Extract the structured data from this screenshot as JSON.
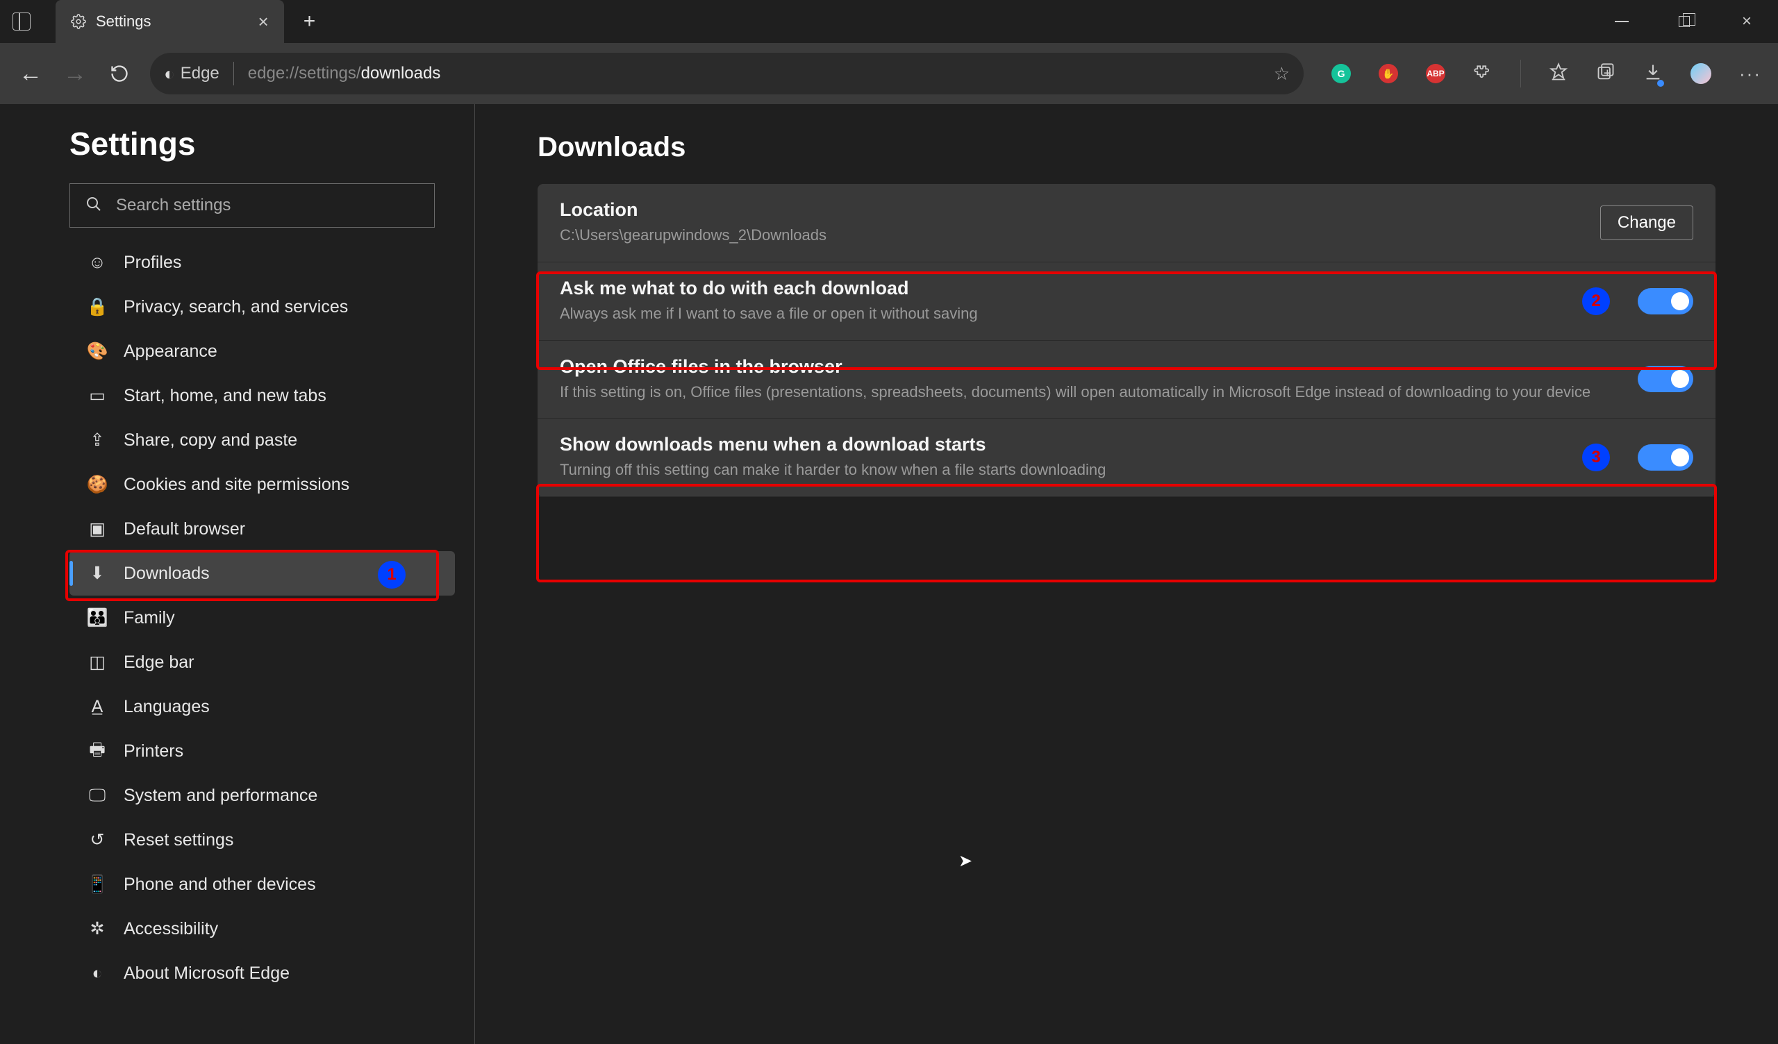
{
  "tab": {
    "title": "Settings"
  },
  "url": {
    "label": "Edge",
    "prefix": "edge://settings/",
    "path": "downloads"
  },
  "sidebar": {
    "heading": "Settings",
    "search_placeholder": "Search settings",
    "items": [
      {
        "label": "Profiles"
      },
      {
        "label": "Privacy, search, and services"
      },
      {
        "label": "Appearance"
      },
      {
        "label": "Start, home, and new tabs"
      },
      {
        "label": "Share, copy and paste"
      },
      {
        "label": "Cookies and site permissions"
      },
      {
        "label": "Default browser"
      },
      {
        "label": "Downloads"
      },
      {
        "label": "Family"
      },
      {
        "label": "Edge bar"
      },
      {
        "label": "Languages"
      },
      {
        "label": "Printers"
      },
      {
        "label": "System and performance"
      },
      {
        "label": "Reset settings"
      },
      {
        "label": "Phone and other devices"
      },
      {
        "label": "Accessibility"
      },
      {
        "label": "About Microsoft Edge"
      }
    ]
  },
  "page": {
    "heading": "Downloads",
    "location": {
      "title": "Location",
      "path": "C:\\Users\\gearupwindows_2\\Downloads",
      "button": "Change"
    },
    "rows": [
      {
        "title": "Ask me what to do with each download",
        "desc": "Always ask me if I want to save a file or open it without saving",
        "on": true
      },
      {
        "title": "Open Office files in the browser",
        "desc": "If this setting is on, Office files (presentations, spreadsheets, documents) will open automatically in Microsoft Edge instead of downloading to your device",
        "on": true
      },
      {
        "title": "Show downloads menu when a download starts",
        "desc": "Turning off this setting can make it harder to know when a file starts downloading",
        "on": true
      }
    ]
  },
  "annotations": {
    "one": "1",
    "two": "2",
    "three": "3"
  }
}
